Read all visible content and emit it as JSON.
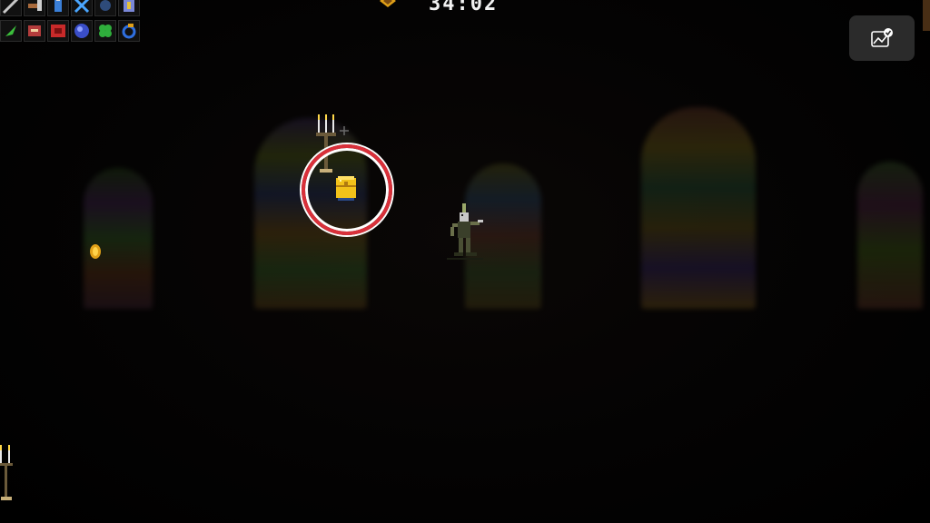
{
  "hud": {
    "timer": "34:02",
    "items_row1": [
      {
        "icon": "whip-icon",
        "color": "#c8c8c8"
      },
      {
        "icon": "axe-icon",
        "color": "#a86a3c"
      },
      {
        "icon": "holy-water-icon",
        "color": "#3a7fd8"
      },
      {
        "icon": "cross-icon",
        "color": "#4aa6ff"
      },
      {
        "icon": "runetracer-icon",
        "color": "#2e4b7a"
      },
      {
        "icon": "bible-icon",
        "color": "#7a88d8"
      }
    ],
    "items_row2": [
      {
        "icon": "spinach-icon",
        "color": "#3cbf3c"
      },
      {
        "icon": "armor-icon",
        "color": "#b33c3c"
      },
      {
        "icon": "hollow-heart-icon",
        "color": "#c82a2a"
      },
      {
        "icon": "empty-tome-icon",
        "color": "#3a4ec8"
      },
      {
        "icon": "clover-icon",
        "color": "#2fae3c"
      },
      {
        "icon": "attractorb-icon",
        "color": "#2f6fe0"
      }
    ]
  },
  "colors": {
    "highlight_ring": "#d9303a",
    "chest_gold": "#f2c21a",
    "coin_gold": "#e0a018",
    "button_bg": "#2b2b2b"
  }
}
